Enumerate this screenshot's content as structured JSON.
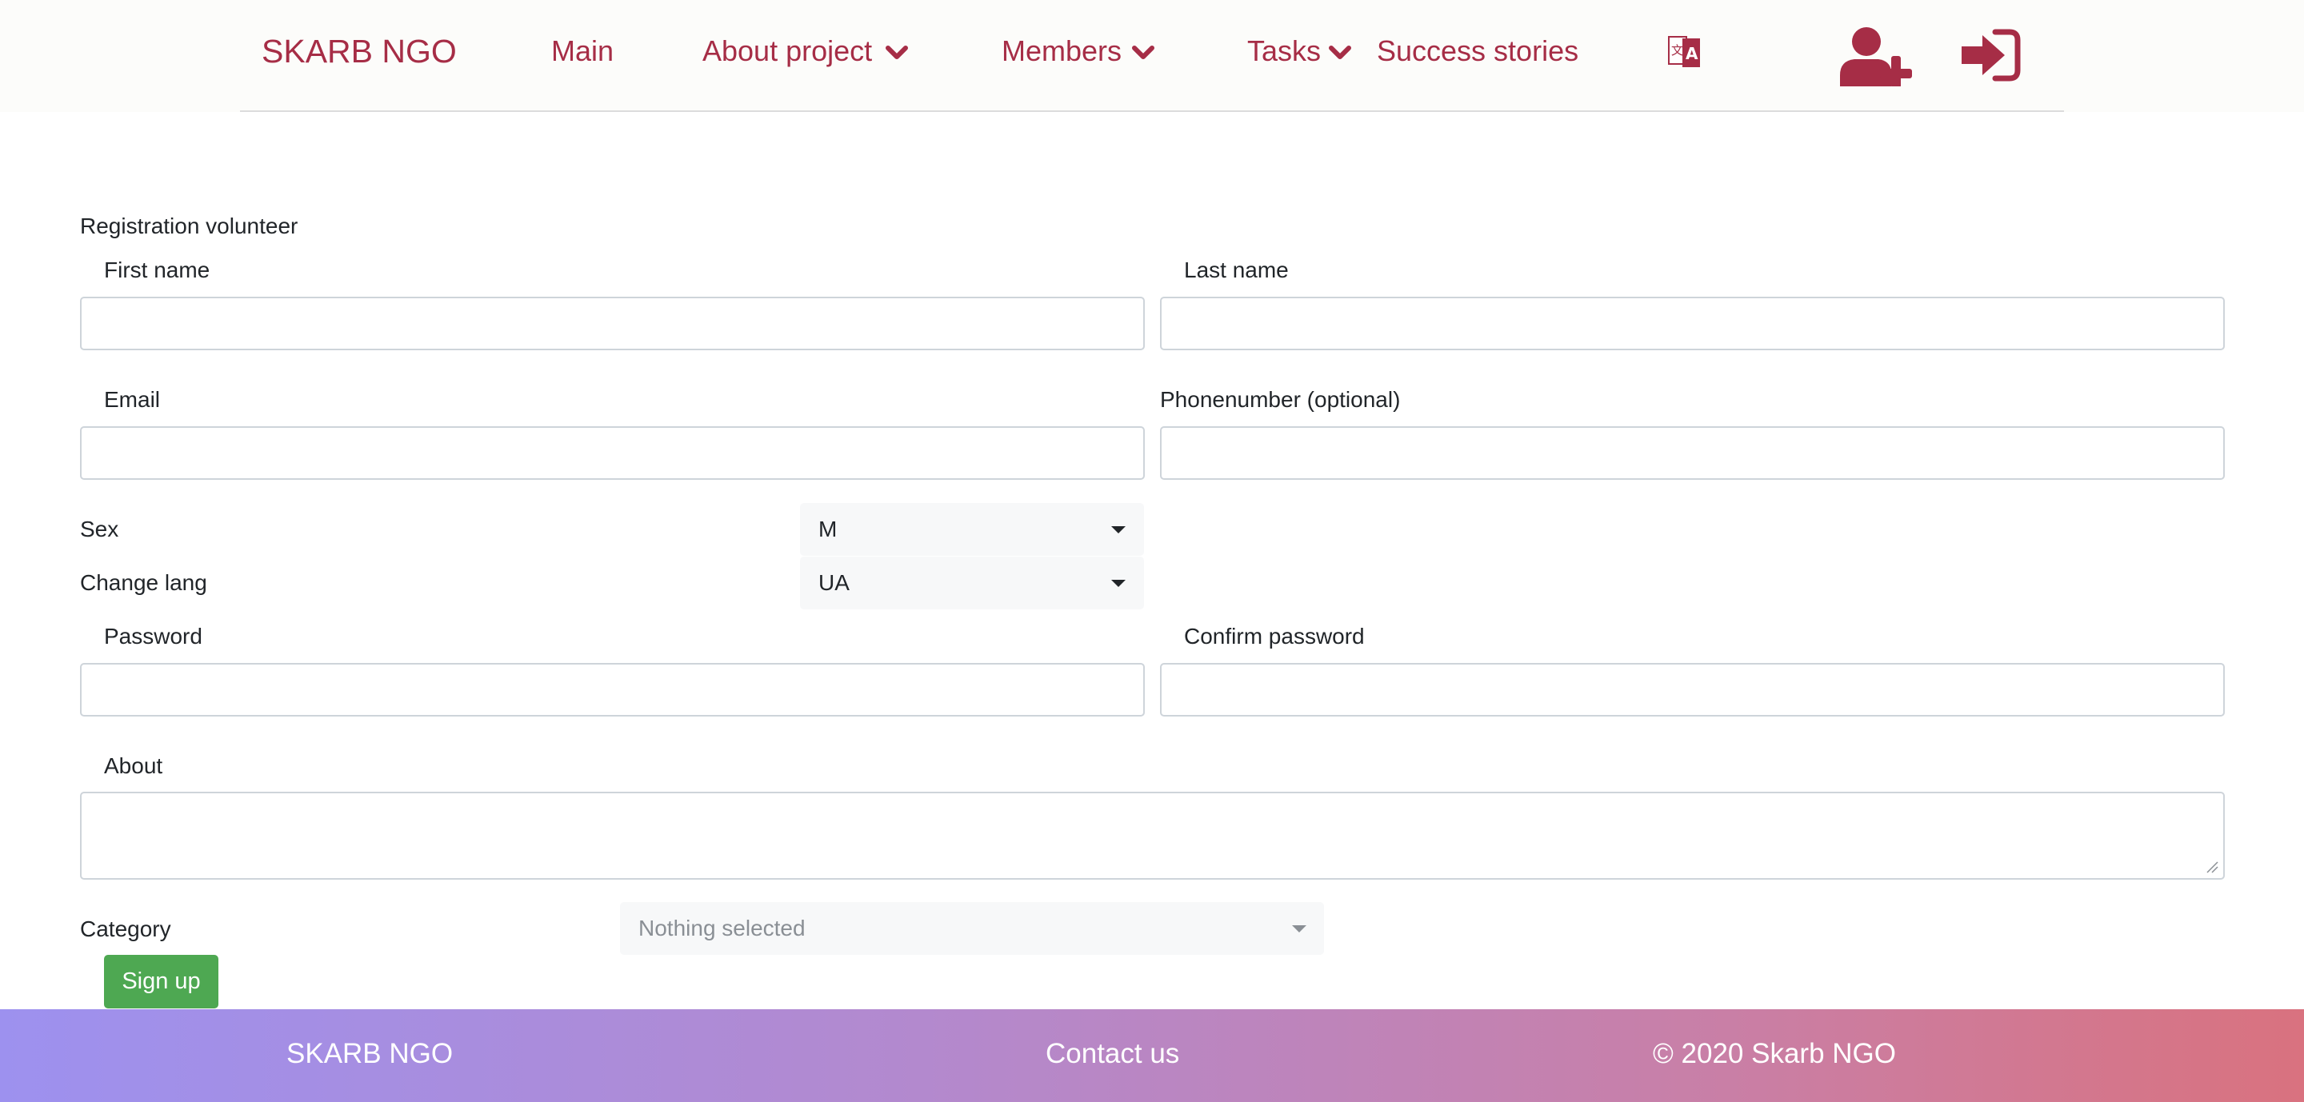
{
  "header": {
    "brand": "SKARB NGO",
    "nav": {
      "main": "Main",
      "about": "About project",
      "members": "Members",
      "tasks": "Tasks",
      "stories": "Success stories"
    },
    "icons": {
      "language": "translate-icon",
      "register": "user-plus-icon",
      "login": "sign-in-icon"
    },
    "accent_color": "#a62d46"
  },
  "form": {
    "title": "Registration volunteer",
    "first_name_label": "First name",
    "first_name_value": "",
    "last_name_label": "Last name",
    "last_name_value": "",
    "email_label": "Email",
    "email_value": "",
    "phone_label": "Phonenumber (optional)",
    "phone_value": "",
    "sex_label": "Sex",
    "sex_value": "M",
    "lang_label": "Change lang",
    "lang_value": "UA",
    "password_label": "Password",
    "confirm_label": "Confirm password",
    "about_label": "About",
    "about_value": "",
    "category_label": "Category",
    "category_placeholder": "Nothing selected",
    "submit_label": "Sign up",
    "submit_color": "#4ea852"
  },
  "footer": {
    "brand": "SKARB NGO",
    "contact": "Contact us",
    "copyright": "© 2020 Skarb NGO"
  }
}
